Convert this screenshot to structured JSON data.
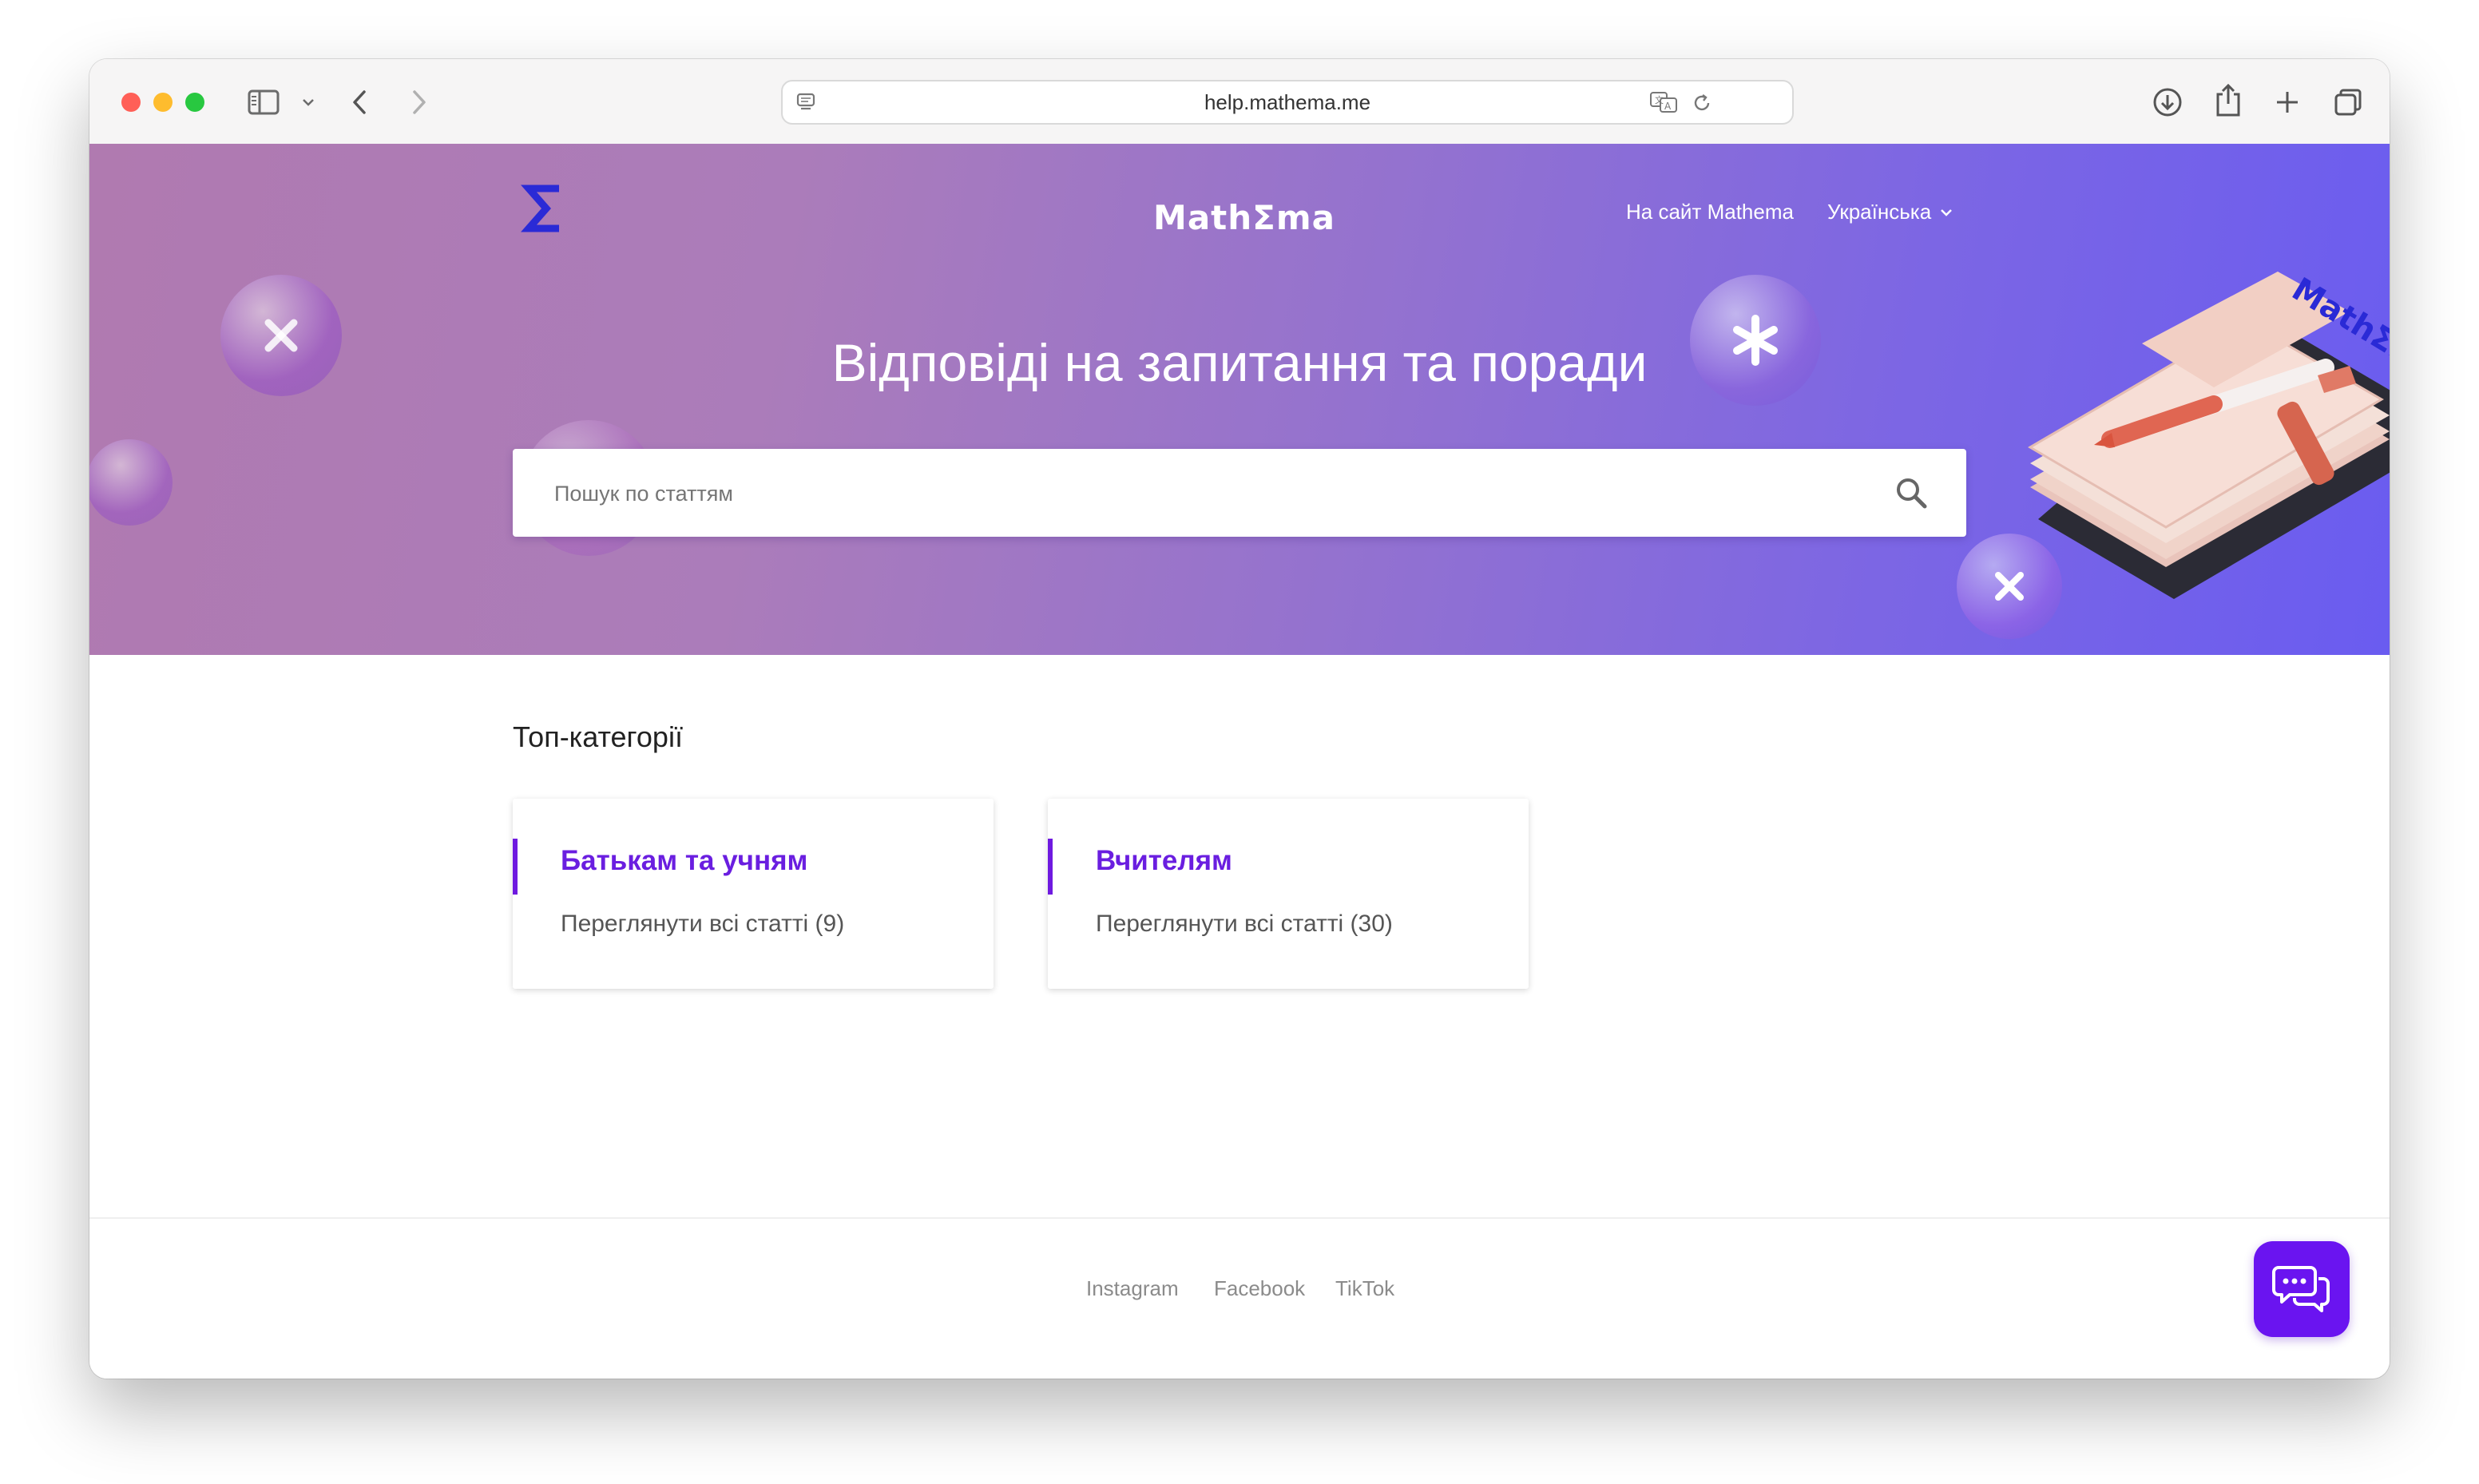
{
  "browser": {
    "url": "help.mathema.me"
  },
  "header": {
    "brand": "MathΣma",
    "nav_link": "На сайт Mathema",
    "language": "Українська",
    "headline": "Відповіді на запитання та поради",
    "search_placeholder": "Пошук по статтям",
    "illustration_brand": "MathΣma"
  },
  "main": {
    "section_title": "Топ-категорії",
    "categories": [
      {
        "title": "Батькам та учням",
        "link": "Переглянути всі статті (9)"
      },
      {
        "title": "Вчителям",
        "link": "Переглянути всі статті (30)"
      }
    ]
  },
  "footer": {
    "links": [
      "Instagram",
      "Facebook",
      "TikTok"
    ]
  },
  "colors": {
    "accent": "#6a1ee0",
    "logo": "#2a2ad6",
    "chat_button": "#6a14f0",
    "hero_start": "#b07ab0",
    "hero_end": "#6a5cf0"
  },
  "icons": [
    "sigma-logo-icon",
    "chevron-down-icon",
    "search-icon",
    "chat-icon",
    "sidebar-icon",
    "back-icon",
    "forward-icon",
    "download-icon",
    "share-icon",
    "new-tab-icon",
    "tabs-icon",
    "translate-icon",
    "reload-icon",
    "reader-icon"
  ]
}
